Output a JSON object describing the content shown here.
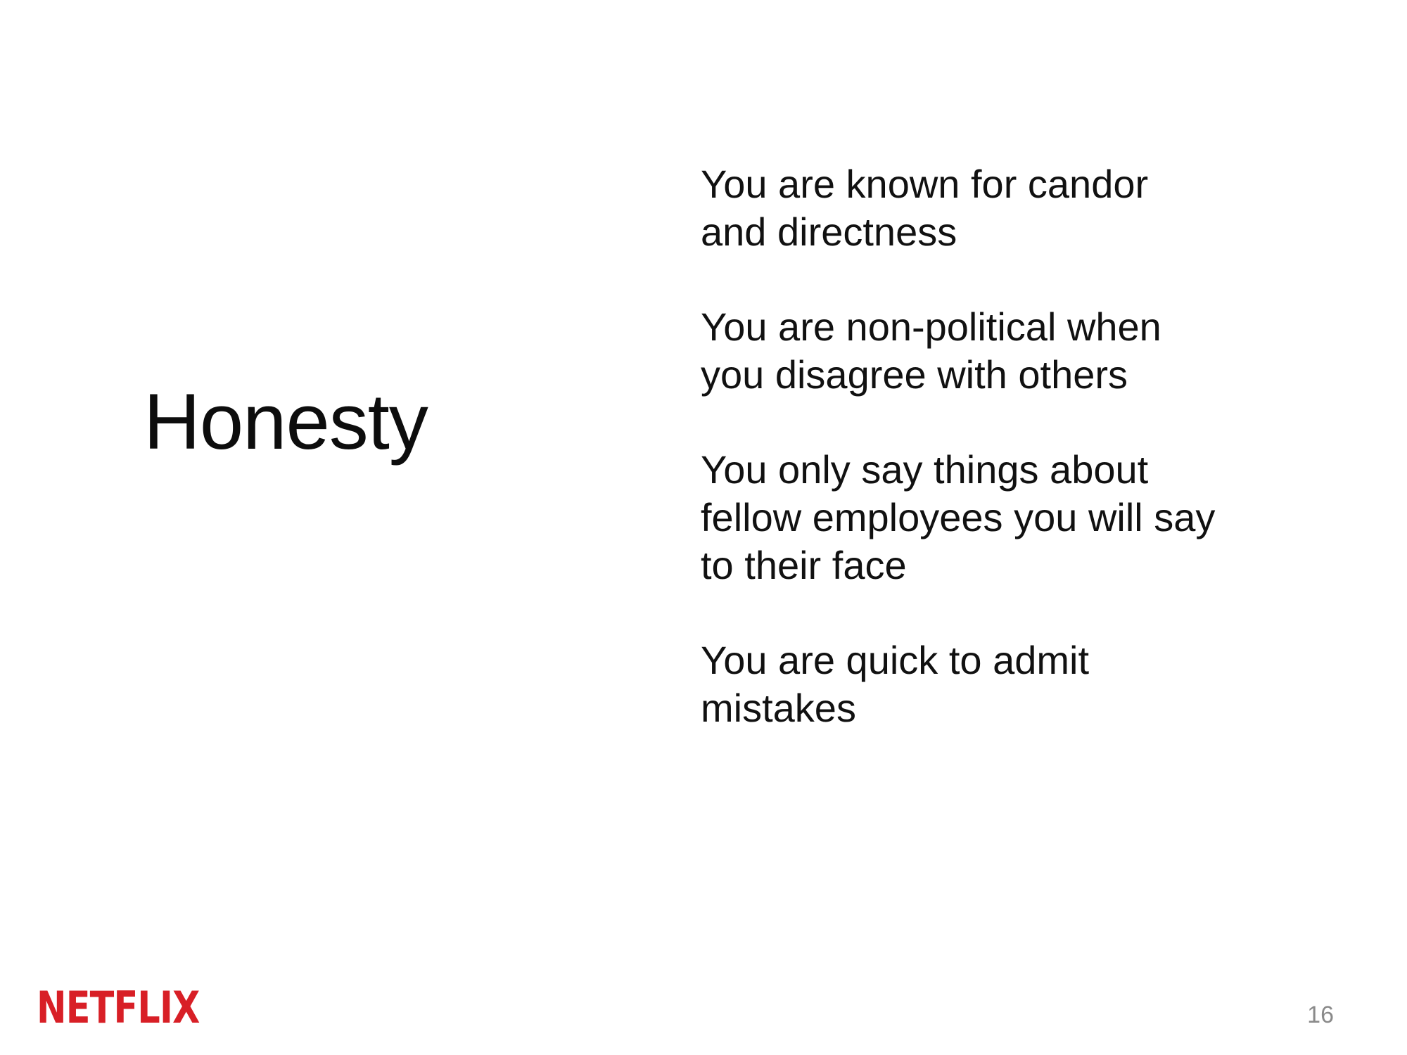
{
  "slide": {
    "title": "Honesty",
    "points": [
      "You are known for candor\nand directness",
      "You are non-political when\nyou disagree with others",
      "You only say things about\nfellow employees you will say\nto their face",
      "You are quick to admit\nmistakes"
    ],
    "logo_text": "NETFLIX",
    "page_number": "16"
  },
  "colors": {
    "text": "#111111",
    "brand": "#d81f26",
    "page_number": "#8a8a8a",
    "background": "#ffffff"
  }
}
